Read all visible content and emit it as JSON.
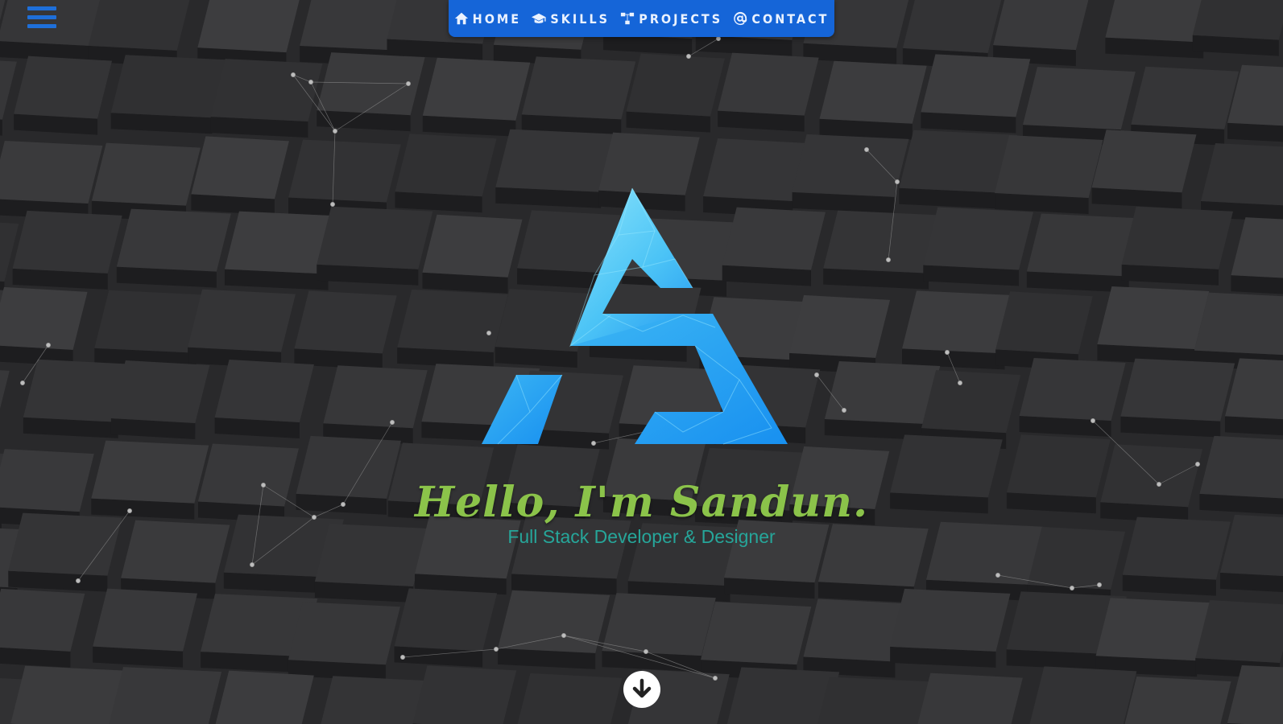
{
  "nav": {
    "items": [
      {
        "label": "HOME",
        "icon": "home-icon"
      },
      {
        "label": "SKILLS",
        "icon": "graduation-cap-icon"
      },
      {
        "label": "PROJECTS",
        "icon": "sitemap-icon"
      },
      {
        "label": "CONTACT",
        "icon": "at-icon"
      }
    ]
  },
  "hero": {
    "greeting": "Hello, I'm Sandun.",
    "role": "Full Stack Developer & Designer"
  },
  "icons": {
    "menu": "hamburger-menu-icon",
    "scroll": "arrow-down-circle-icon",
    "logo": "triangle-s-logo"
  },
  "colors": {
    "nav_bg": "#1565d8",
    "greeting": "#8bc34a",
    "role": "#26a69a",
    "logo_light": "#5ad0f7",
    "logo_dark": "#1a8cf0",
    "background": "#2b2b2d"
  }
}
